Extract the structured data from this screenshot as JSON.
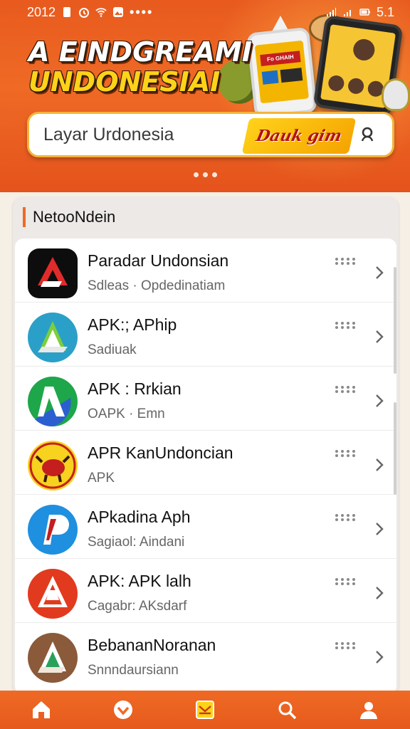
{
  "status_bar": {
    "time": "2012",
    "battery": "5.1"
  },
  "banner": {
    "title_line1": "A EINDGREAMI",
    "title_line2": "UNDONESIAI",
    "phone1_tag": "Fo GHAIH",
    "carousel_dots": 3
  },
  "search": {
    "placeholder": "Layar Urdonesia",
    "promo_text": "Dauk gim"
  },
  "section": {
    "title": "NetooNdein"
  },
  "apps": [
    {
      "name": "Paradar Undonsian",
      "subtitle": "Sdleas · Opdedinatiam",
      "icon": "apk-logo-black"
    },
    {
      "name": "APK:; APhip",
      "subtitle": "Sadiuak",
      "icon": "apk-logo-blue"
    },
    {
      "name": "APK : Rrkian",
      "subtitle": "OAPK · Emn",
      "icon": "apk-logo-green"
    },
    {
      "name": "APR KanUndoncian",
      "subtitle": "APK",
      "icon": "bull-logo-yellow"
    },
    {
      "name": "APkadina Aph",
      "subtitle": "Sagiaol: Aindani",
      "icon": "apk-logo-lightblue"
    },
    {
      "name": "APK: APK lalh",
      "subtitle": "Cagabr: AKsdarf",
      "icon": "apk-logo-red"
    },
    {
      "name": "BebananNoranan",
      "subtitle": "Snnndaursiann",
      "icon": "apk-logo-brown"
    }
  ],
  "bottom_nav": [
    "home-icon",
    "favorite-icon",
    "inbox-icon",
    "search-icon",
    "profile-icon"
  ],
  "colors": {
    "accent": "#ef6a25",
    "highlight": "#ffd21a"
  }
}
